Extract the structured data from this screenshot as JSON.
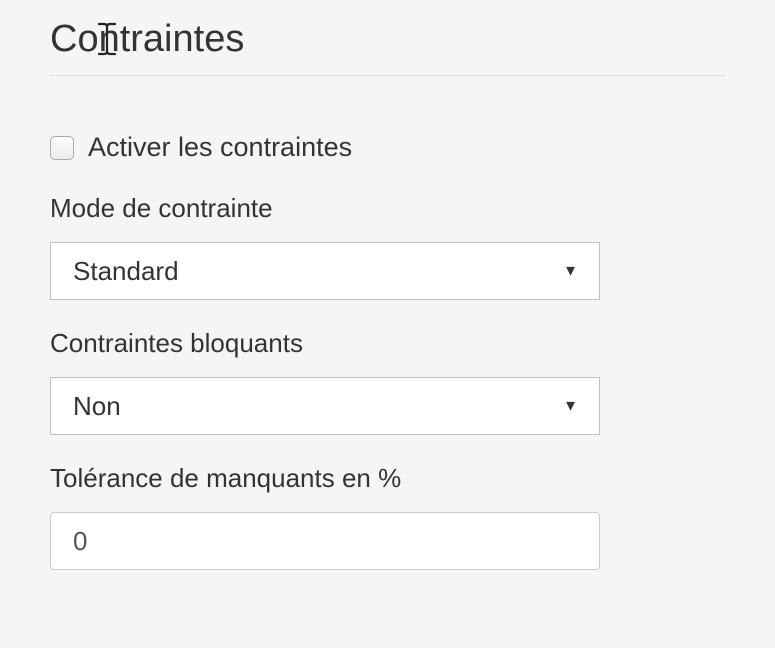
{
  "section": {
    "title": "Contraintes"
  },
  "activate": {
    "label": "Activer les contraintes",
    "checked": false
  },
  "mode": {
    "label": "Mode de contrainte",
    "value": "Standard"
  },
  "blocking": {
    "label": "Contraintes bloquants",
    "value": "Non"
  },
  "tolerance": {
    "label": "Tolérance de manquants en %",
    "value": "0"
  }
}
